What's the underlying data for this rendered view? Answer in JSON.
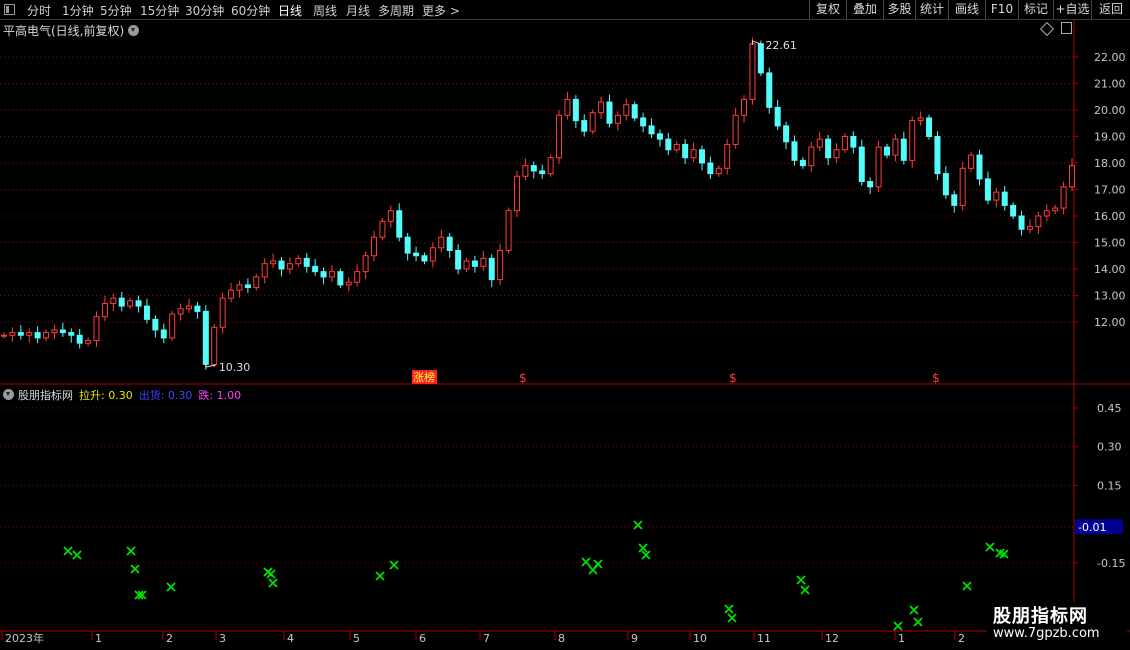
{
  "toolbar": {
    "periods": [
      "分时",
      "1分钟",
      "5分钟",
      "15分钟",
      "30分钟",
      "60分钟",
      "日线",
      "周线",
      "月线",
      "多周期",
      "更多 >"
    ],
    "active_period": "日线",
    "tools": [
      "复权",
      "叠加",
      "多股",
      "统计",
      "画线",
      "F10",
      "标记",
      "+自选",
      "返回"
    ]
  },
  "main_panel": {
    "title": "平高电气(日线,前复权)",
    "price_axis": [
      "22.00",
      "21.00",
      "20.00",
      "19.00",
      "18.00",
      "17.00",
      "16.00",
      "15.00",
      "14.00",
      "13.00",
      "12.00"
    ],
    "high_label": "22.61",
    "low_label": "10.30",
    "markers": [
      {
        "text": "涨榜",
        "kind": "tag"
      },
      {
        "text": "$",
        "kind": "s"
      },
      {
        "text": "$",
        "kind": "s"
      },
      {
        "text": "$",
        "kind": "s"
      }
    ]
  },
  "indicator_panel": {
    "name": "股朋指标网",
    "lines": [
      {
        "label": "拉升:",
        "value": "0.30",
        "color": "#e6e600"
      },
      {
        "label": "出货:",
        "value": "0.30",
        "color": "#4040ff"
      },
      {
        "label": "跌:",
        "value": "1.00",
        "color": "#ff40ff"
      }
    ],
    "axis": [
      "0.45",
      "0.30",
      "0.15",
      "-0.15"
    ],
    "current_value": "-0.01"
  },
  "time_axis": [
    "2023年",
    "1",
    "2",
    "3",
    "4",
    "5",
    "6",
    "7",
    "8",
    "9",
    "10",
    "11",
    "12",
    "1",
    "2"
  ],
  "watermark": {
    "line1": "股朋指标网",
    "line2": "www.7gpzb.com"
  },
  "colors": {
    "up": "#ff3c3c",
    "down": "#54fcfc",
    "grid": "#8b0000",
    "signal": "#00e000",
    "axis_text": "#c8c8c8"
  },
  "chart_data": {
    "type": "candlestick",
    "title": "平高电气(日线,前复权)",
    "x_range": [
      "2023-01",
      "2024-02"
    ],
    "y_range": [
      10.3,
      22.61
    ],
    "series": [
      {
        "values": [
          11.5,
          11.6,
          11.5,
          11.6,
          11.4,
          11.6,
          11.7,
          11.6,
          11.5,
          11.2,
          11.3,
          12.2,
          12.7,
          12.9,
          12.6,
          12.8,
          12.6,
          12.1,
          11.7,
          11.4,
          12.3,
          12.5,
          12.6,
          12.4,
          10.4,
          11.8,
          12.9,
          13.2,
          13.4,
          13.3,
          13.7,
          14.2,
          14.3,
          14.0,
          14.2,
          14.4,
          14.1,
          13.9,
          13.7,
          13.9,
          13.4,
          13.5,
          13.9,
          14.5,
          15.2,
          15.8,
          16.2,
          15.2,
          14.6,
          14.5,
          14.3,
          14.8,
          15.2,
          14.7,
          14.0,
          14.3,
          14.1,
          14.4,
          13.6,
          14.7,
          16.2,
          17.5,
          17.9,
          17.7,
          17.6,
          18.2,
          19.8,
          20.4,
          19.6,
          19.2,
          19.9,
          20.3,
          19.5,
          19.8,
          20.2,
          19.7,
          19.4,
          19.1,
          18.9,
          18.5,
          18.7,
          18.2,
          18.5,
          18.0,
          17.6,
          17.8,
          18.7,
          19.8,
          20.4,
          22.5,
          21.4,
          20.1,
          19.4,
          18.8,
          18.1,
          17.9,
          18.6,
          18.9,
          18.2,
          18.5,
          19.0,
          18.6,
          17.3,
          17.1,
          18.6,
          18.3,
          18.9,
          18.1,
          19.6,
          19.7,
          19.0,
          17.6,
          16.8,
          16.4,
          17.8,
          18.3,
          17.4,
          16.6,
          16.9,
          16.4,
          16.0,
          15.5,
          15.6,
          16.0,
          16.2,
          16.3,
          17.1,
          17.9
        ]
      }
    ]
  }
}
